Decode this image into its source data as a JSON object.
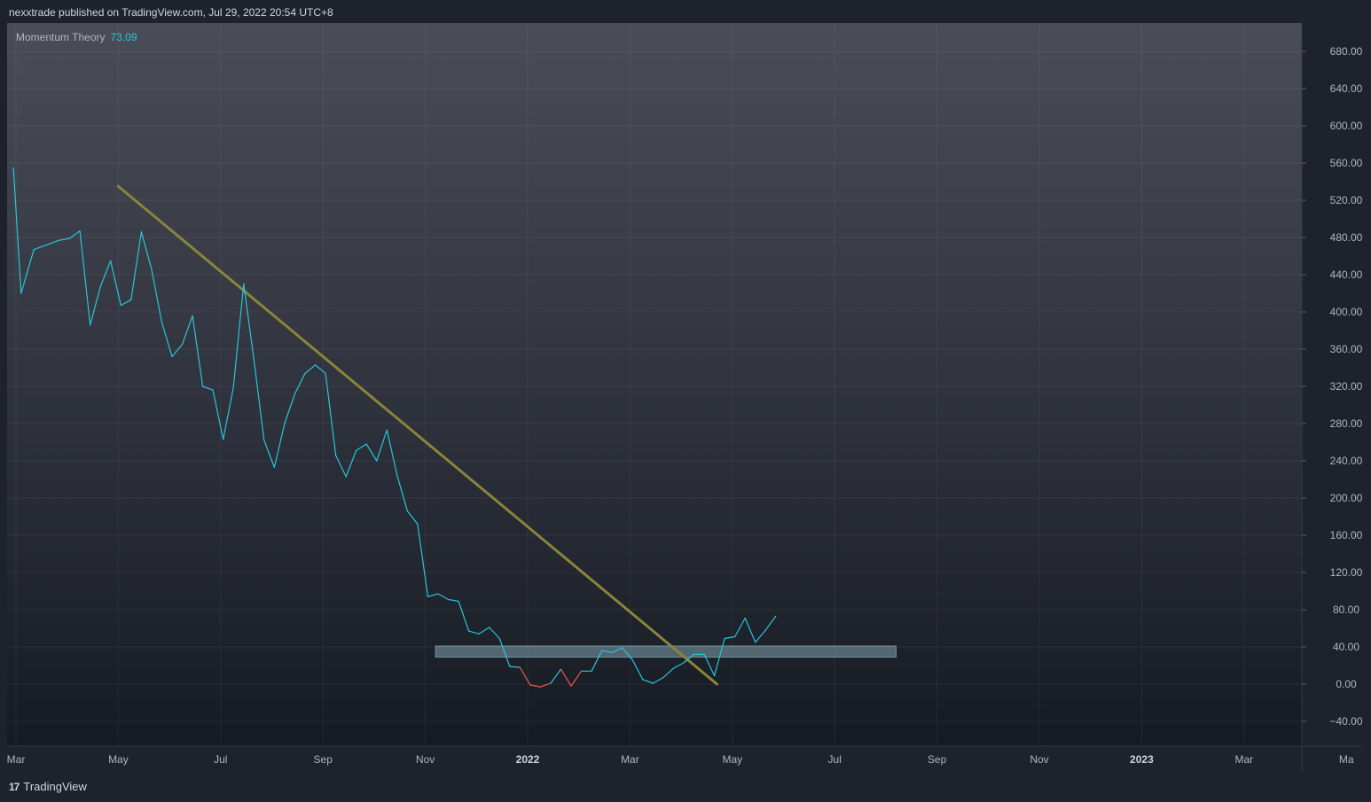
{
  "header": {
    "attribution": "nexxtrade published on TradingView.com, Jul 29, 2022 20:54 UTC+8"
  },
  "legend": {
    "name": "Momentum Theory",
    "value": "73.09",
    "value_color": "#26c6da"
  },
  "footer": {
    "brand": "TradingView",
    "logo_icon": "tradingview-logo-icon"
  },
  "chart_data": {
    "type": "line",
    "y_axis": {
      "position": "right",
      "range": [
        -60,
        700
      ],
      "ticks": [
        "680.00",
        "640.00",
        "600.00",
        "560.00",
        "520.00",
        "480.00",
        "440.00",
        "400.00",
        "360.00",
        "320.00",
        "280.00",
        "240.00",
        "200.00",
        "160.00",
        "120.00",
        "80.00",
        "40.00",
        "0.00",
        "−40.00"
      ],
      "tick_values": [
        680,
        640,
        600,
        560,
        520,
        480,
        440,
        400,
        360,
        320,
        280,
        240,
        200,
        160,
        120,
        80,
        40,
        0,
        -40
      ]
    },
    "x_axis": {
      "range": [
        0,
        24
      ],
      "ticks": [
        {
          "label": "Mar",
          "m": 0,
          "bold": false
        },
        {
          "label": "May",
          "m": 2,
          "bold": false
        },
        {
          "label": "Jul",
          "m": 4,
          "bold": false
        },
        {
          "label": "Sep",
          "m": 6,
          "bold": false
        },
        {
          "label": "Nov",
          "m": 8,
          "bold": false
        },
        {
          "label": "2022",
          "m": 10,
          "bold": true
        },
        {
          "label": "Mar",
          "m": 12,
          "bold": false
        },
        {
          "label": "May",
          "m": 14,
          "bold": false
        },
        {
          "label": "Jul",
          "m": 16,
          "bold": false
        },
        {
          "label": "Sep",
          "m": 18,
          "bold": false
        },
        {
          "label": "Nov",
          "m": 20,
          "bold": false
        },
        {
          "label": "2023",
          "m": 22,
          "bold": true
        },
        {
          "label": "Mar",
          "m": 24,
          "bold": false
        },
        {
          "label": "Ma",
          "m": 26,
          "bold": false
        }
      ]
    },
    "grid": true,
    "colors": {
      "line_up": "#26c6da",
      "line_down": "#ef5350",
      "trendline": "#8a843a",
      "zone": "#7fa3ad"
    },
    "series": [
      {
        "points": [
          [
            -0.05,
            555
          ],
          [
            0.1,
            420
          ],
          [
            0.35,
            467
          ],
          [
            0.6,
            472
          ],
          [
            0.85,
            477
          ],
          [
            1.05,
            479
          ],
          [
            1.25,
            487
          ],
          [
            1.45,
            386
          ],
          [
            1.65,
            427
          ],
          [
            1.85,
            455
          ],
          [
            2.05,
            407
          ],
          [
            2.25,
            413
          ],
          [
            2.45,
            486
          ],
          [
            2.65,
            446
          ],
          [
            2.85,
            389
          ],
          [
            3.05,
            352
          ],
          [
            3.25,
            365
          ],
          [
            3.45,
            396
          ],
          [
            3.65,
            320
          ],
          [
            3.85,
            316
          ],
          [
            4.05,
            263
          ],
          [
            4.25,
            319
          ],
          [
            4.45,
            430
          ],
          [
            4.65,
            349
          ],
          [
            4.85,
            262
          ],
          [
            5.05,
            233
          ],
          [
            5.25,
            280
          ],
          [
            5.45,
            312
          ],
          [
            5.65,
            334
          ],
          [
            5.85,
            343
          ],
          [
            6.05,
            334
          ],
          [
            6.25,
            246
          ],
          [
            6.45,
            223
          ],
          [
            6.65,
            251
          ],
          [
            6.85,
            258
          ],
          [
            7.05,
            240
          ],
          [
            7.25,
            273
          ],
          [
            7.45,
            224
          ],
          [
            7.65,
            186
          ],
          [
            7.85,
            172
          ],
          [
            8.05,
            94
          ],
          [
            8.25,
            97
          ],
          [
            8.45,
            91
          ],
          [
            8.65,
            89
          ],
          [
            8.85,
            57
          ],
          [
            9.05,
            54
          ],
          [
            9.25,
            61
          ],
          [
            9.45,
            49
          ],
          [
            9.65,
            19
          ],
          [
            9.85,
            18
          ],
          [
            10.05,
            -1
          ],
          [
            10.25,
            -3
          ],
          [
            10.45,
            1
          ],
          [
            10.65,
            16
          ],
          [
            10.85,
            -2
          ],
          [
            11.05,
            14
          ],
          [
            11.25,
            14
          ],
          [
            11.45,
            36
          ],
          [
            11.65,
            34
          ],
          [
            11.85,
            39
          ],
          [
            12.05,
            26
          ],
          [
            12.25,
            5
          ],
          [
            12.45,
            1
          ],
          [
            12.65,
            7
          ],
          [
            12.85,
            17
          ],
          [
            13.05,
            23
          ],
          [
            13.25,
            32
          ],
          [
            13.45,
            32
          ],
          [
            13.65,
            9
          ],
          [
            13.85,
            49
          ],
          [
            14.05,
            51
          ],
          [
            14.25,
            71
          ],
          [
            14.45,
            45
          ],
          [
            14.65,
            58
          ],
          [
            14.85,
            73
          ]
        ]
      }
    ],
    "trendline": {
      "from": [
        2.0,
        535
      ],
      "to": [
        13.7,
        0
      ]
    },
    "zone": {
      "x0": 8.2,
      "x1": 17.2,
      "y0": 29,
      "y1": 41
    }
  }
}
